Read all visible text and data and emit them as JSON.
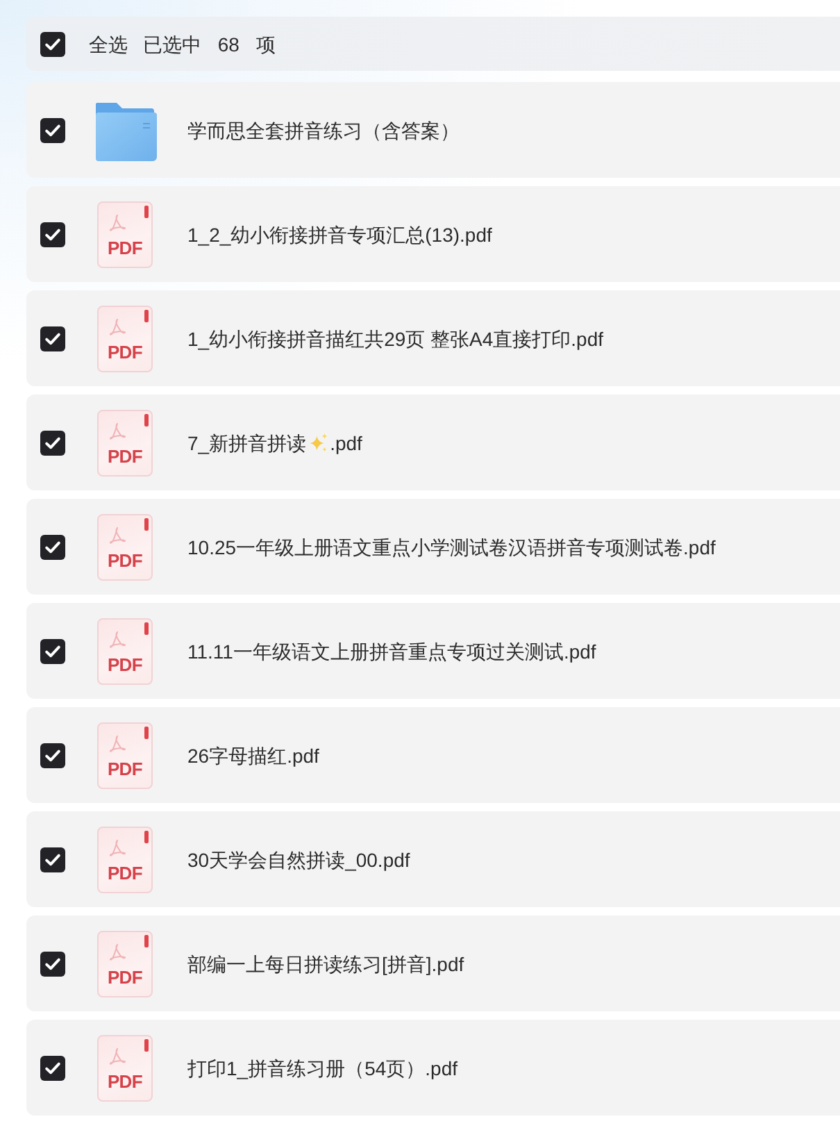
{
  "header": {
    "checked": true,
    "select_all_label": "全选",
    "selection_status": "已选中 68 项"
  },
  "files": [
    {
      "kind": "folder",
      "checked": true,
      "name": [
        {
          "kind": "text",
          "text": "学而思全套拼音练习（含答案）"
        }
      ]
    },
    {
      "kind": "pdf",
      "type_label": "PDF",
      "checked": true,
      "name": [
        {
          "kind": "text",
          "text": "1_2_幼小衔接拼音专项汇总(13).pdf"
        }
      ]
    },
    {
      "kind": "pdf",
      "type_label": "PDF",
      "checked": true,
      "name": [
        {
          "kind": "text",
          "text": "1_幼小衔接拼音描红共29页 整张A4直接打印.pdf"
        }
      ]
    },
    {
      "kind": "pdf",
      "type_label": "PDF",
      "checked": true,
      "name": [
        {
          "kind": "text",
          "text": "7_新拼音拼读"
        },
        {
          "kind": "emoji"
        },
        {
          "kind": "text",
          "text": ".pdf"
        }
      ]
    },
    {
      "kind": "pdf",
      "type_label": "PDF",
      "checked": true,
      "name": [
        {
          "kind": "text",
          "text": "10.25一年级上册语文重点小学测试卷汉语拼音专项测试卷.pdf"
        }
      ]
    },
    {
      "kind": "pdf",
      "type_label": "PDF",
      "checked": true,
      "name": [
        {
          "kind": "text",
          "text": "11.11一年级语文上册拼音重点专项过关测试.pdf"
        }
      ]
    },
    {
      "kind": "pdf",
      "type_label": "PDF",
      "checked": true,
      "name": [
        {
          "kind": "text",
          "text": "26字母描红.pdf"
        }
      ]
    },
    {
      "kind": "pdf",
      "type_label": "PDF",
      "checked": true,
      "name": [
        {
          "kind": "text",
          "text": "30天学会自然拼读_00.pdf"
        }
      ]
    },
    {
      "kind": "pdf",
      "type_label": "PDF",
      "checked": true,
      "name": [
        {
          "kind": "text",
          "text": "部编一上每日拼读练习[拼音].pdf"
        }
      ]
    },
    {
      "kind": "pdf",
      "type_label": "PDF",
      "checked": true,
      "name": [
        {
          "kind": "text",
          "text": "打印1_拼音练习册（54页）.pdf"
        }
      ]
    }
  ]
}
